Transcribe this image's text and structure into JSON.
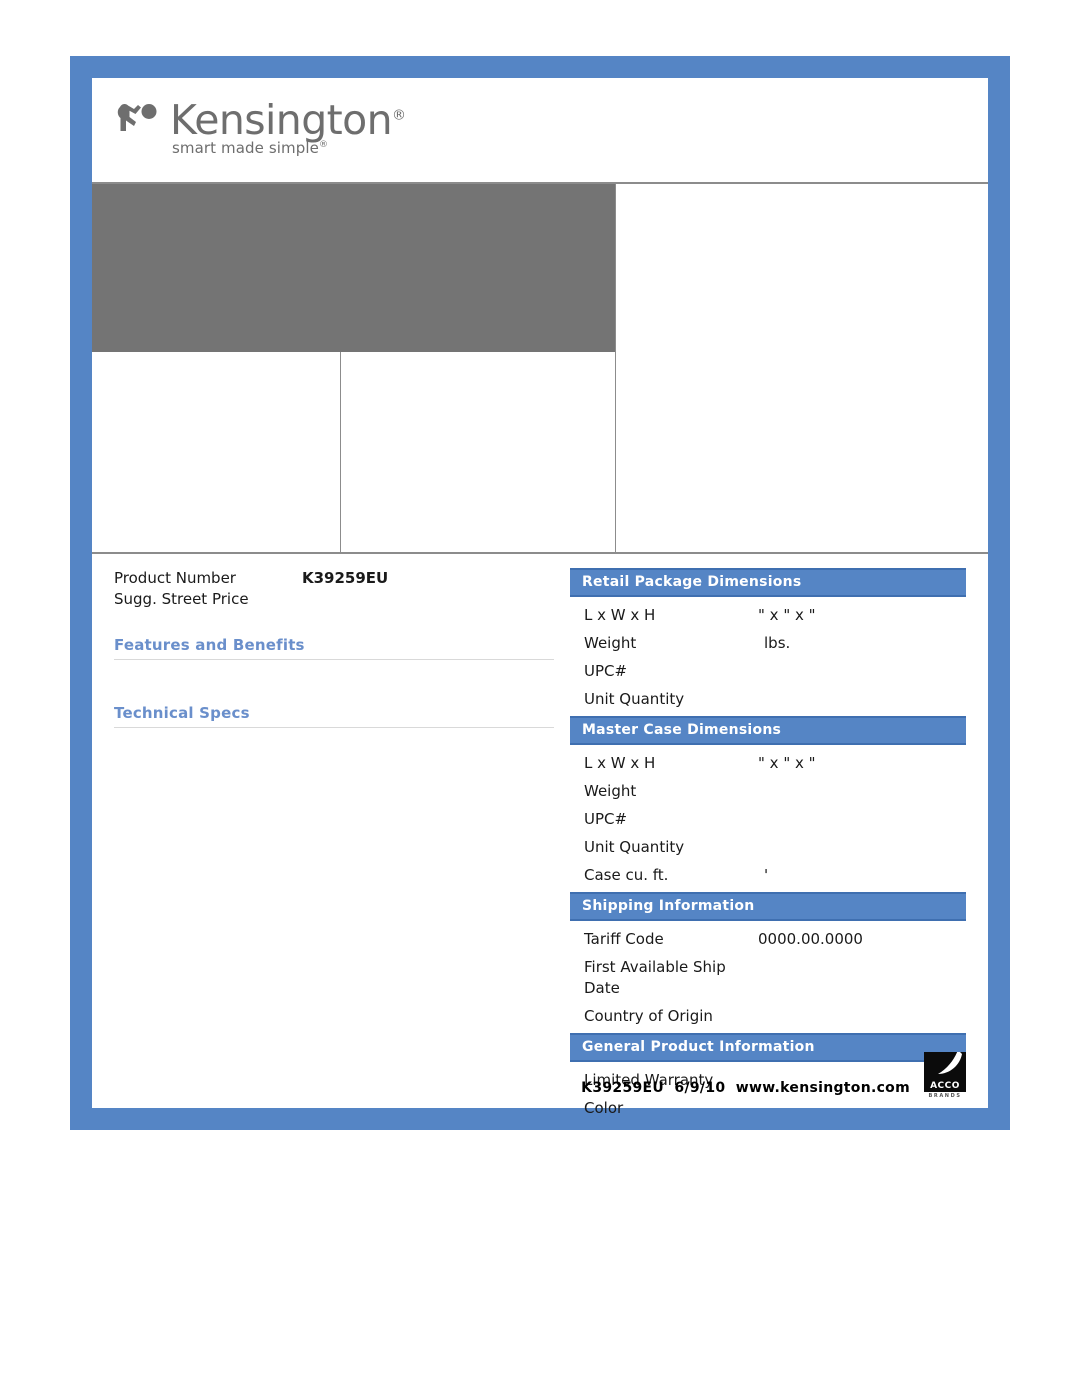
{
  "brand": {
    "logo_word": "Kensington",
    "logo_registered": "®",
    "tagline": "smart made simple",
    "tagline_registered": "®",
    "logo_icon": "kensington-figure-mark",
    "frame_color": "#5585c5",
    "heading_color": "#6a8fcb",
    "placeholder_color": "#747474"
  },
  "product": {
    "product_number_label": "Product Number",
    "product_number_value": "K39259EU",
    "price_label": "Sugg. Street Price",
    "price_value": ""
  },
  "left_sections": {
    "features_title": "Features and Benefits",
    "specs_title": "Technical Specs"
  },
  "panels": [
    {
      "title": "Retail Package Dimensions",
      "rows": [
        {
          "label": "L x W x H",
          "value": "\" x \" x \"",
          "indent": false
        },
        {
          "label": "Weight",
          "value": "lbs.",
          "indent": true
        },
        {
          "label": "UPC#",
          "value": "",
          "indent": false
        },
        {
          "label": "Unit Quantity",
          "value": "",
          "indent": false
        }
      ]
    },
    {
      "title": "Master Case Dimensions",
      "rows": [
        {
          "label": "L x W x H",
          "value": "\" x \" x \"",
          "indent": false
        },
        {
          "label": "Weight",
          "value": "",
          "indent": false
        },
        {
          "label": "UPC#",
          "value": "",
          "indent": false
        },
        {
          "label": "Unit Quantity",
          "value": "",
          "indent": false
        },
        {
          "label": "Case cu. ft.",
          "value": "'",
          "indent": true
        }
      ]
    },
    {
      "title": "Shipping Information",
      "rows": [
        {
          "label": "Tariff Code",
          "value": "0000.00.0000",
          "indent": false
        },
        {
          "label": "First Available Ship Date",
          "value": "",
          "indent": false
        },
        {
          "label": "Country of Origin",
          "value": "",
          "indent": false
        }
      ]
    },
    {
      "title": "General Product Information",
      "rows": [
        {
          "label": "Limited Warranty",
          "value": "",
          "indent": false
        },
        {
          "label": "Color",
          "value": "",
          "indent": false
        }
      ]
    }
  ],
  "footer": {
    "text": "K39259EU  6/9/10  www.kensington.com",
    "acco_word": "ACCO",
    "acco_sub": "BRANDS",
    "acco_icon": "acco-brands-logo"
  }
}
